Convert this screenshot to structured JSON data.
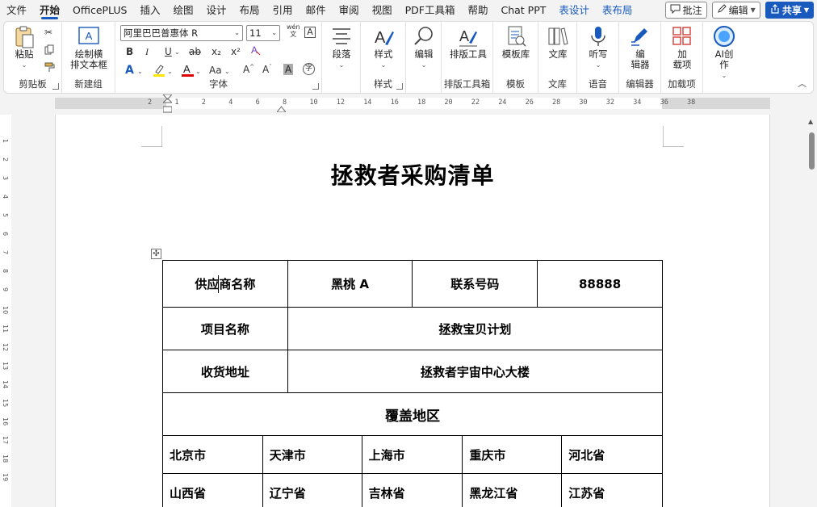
{
  "menu": {
    "tabs": [
      "文件",
      "开始",
      "OfficePLUS",
      "插入",
      "绘图",
      "设计",
      "布局",
      "引用",
      "邮件",
      "审阅",
      "视图",
      "PDF工具箱",
      "帮助",
      "Chat PPT"
    ],
    "context_tabs": [
      "表设计",
      "表布局"
    ],
    "active_tab": "开始",
    "comment_label": "批注",
    "edit_label": "编辑",
    "share_label": "共享"
  },
  "ribbon": {
    "clipboard": {
      "paste": "粘贴",
      "label": "剪贴板"
    },
    "newgroup": {
      "button_line1": "绘制横",
      "button_line2": "排文本框",
      "label": "新建组"
    },
    "font": {
      "font_name": "阿里巴巴普惠体 R",
      "font_size": "11",
      "label": "字体",
      "bold": "B",
      "italic": "I",
      "underline": "U",
      "strike": "ab",
      "sub": "x₂",
      "sup": "x²",
      "grow": "A^",
      "shrink": "Aˇ",
      "case": "Aa",
      "wen": "wén",
      "wen2": "文"
    },
    "paragraph": {
      "label": "段落"
    },
    "styles": {
      "button": "样式",
      "label": "样式"
    },
    "editing": {
      "button": "编辑"
    },
    "typeset": {
      "button": "排版工具",
      "label": "排版工具箱"
    },
    "template": {
      "button": "模板库",
      "label": "模板"
    },
    "library": {
      "button": "文库",
      "label": "文库"
    },
    "voice": {
      "button": "听写",
      "label": "语音"
    },
    "editor": {
      "button_line1": "编",
      "button_line2": "辑器",
      "label": "编辑器"
    },
    "addins": {
      "button_line1": "加",
      "button_line2": "载项",
      "label": "加载项"
    },
    "ai": {
      "button_line1": "AI创",
      "button_line2": "作"
    }
  },
  "ruler": {
    "h_numbers": [
      "2",
      "1",
      "2",
      "4",
      "6",
      "8",
      "10",
      "12",
      "14",
      "16",
      "18",
      "20",
      "22",
      "24",
      "26",
      "28",
      "30",
      "32",
      "34",
      "36",
      "38"
    ],
    "v_numbers": [
      "1",
      "2",
      "3",
      "4",
      "5",
      "6",
      "7",
      "8",
      "9",
      "10",
      "11",
      "12",
      "13",
      "14",
      "15",
      "16",
      "17",
      "18",
      "19"
    ]
  },
  "document": {
    "title": "拯救者采购清单",
    "table": {
      "supplier_label": "供应商名称",
      "supplier_value": "黑桃 A",
      "phone_label": "联系号码",
      "phone_value": "88888",
      "project_label": "项目名称",
      "project_value": "拯救宝贝计划",
      "address_label": "收货地址",
      "address_value": "拯救者宇宙中心大楼",
      "coverage_label": "覆盖地区",
      "regions_row1": [
        "北京市",
        "天津市",
        "上海市",
        "重庆市",
        "河北省"
      ],
      "regions_row2": [
        "山西省",
        "辽宁省",
        "吉林省",
        "黑龙江省",
        "江苏省"
      ]
    }
  },
  "colors": {
    "accent": "#185abd",
    "ribbon_bg": "#ffffff",
    "app_bg": "#f3f3f3"
  }
}
